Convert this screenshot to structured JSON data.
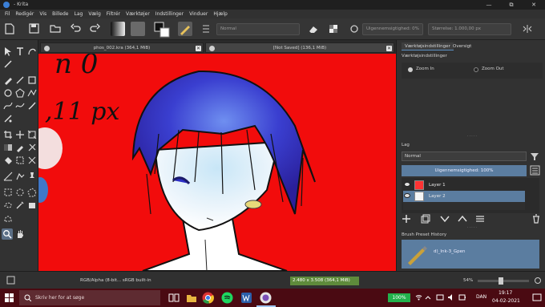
{
  "window": {
    "title": "- Krita",
    "min": "—",
    "max": "⧉",
    "close": "✕"
  },
  "menu": [
    "Fil",
    "Redigér",
    "Vis",
    "Billede",
    "Lag",
    "Vælg",
    "Filtrér",
    "Værktøjer",
    "Indstillinger",
    "Vinduer",
    "Hjælp"
  ],
  "toolbar": {
    "blend_mode": "Normal",
    "opacity_label": "Uigennemsigtighed: 0%",
    "size_label": "Størrelse: 1.000,00 px"
  },
  "documents": [
    {
      "title": "phos_002.kra (364,1 MiB)",
      "active": false
    },
    {
      "title": "[Not Saved] (136,1 MiB)",
      "active": true
    }
  ],
  "canvas_text": {
    "line1": "n 0",
    "line2": ",11 px"
  },
  "docker": {
    "tabs": [
      "Værktøjsindstillinger",
      "Oversigt"
    ],
    "tool_options_title": "Værktøjsindstillinger",
    "zoom_in": "Zoom In",
    "zoom_out": "Zoom Out",
    "layers_title": "Lag",
    "layer_blend": "Normal",
    "layer_opacity": "Uigennemsigtighed: 100%",
    "layers": [
      {
        "name": "Layer 1"
      },
      {
        "name": "Layer 2"
      }
    ],
    "brush_history_title": "Brush Preset History",
    "brush_preset": "d)_Ink-3_Gpen"
  },
  "status": {
    "color_info": "RGB/Alpha (8-bit... sRGB built-in",
    "dimensions": "2.480 x 3.508 (364,1 MiB)",
    "zoom": "54%"
  },
  "taskbar": {
    "search_placeholder": "Skriv her for at søge",
    "battery": "100%",
    "language": "DAN",
    "time": "19:17",
    "date": "04-02-2021"
  },
  "colors": {
    "canvas_red": "#f20c0c",
    "accent_blue": "#5b8ec0",
    "taskbar": "#4a0a12"
  }
}
